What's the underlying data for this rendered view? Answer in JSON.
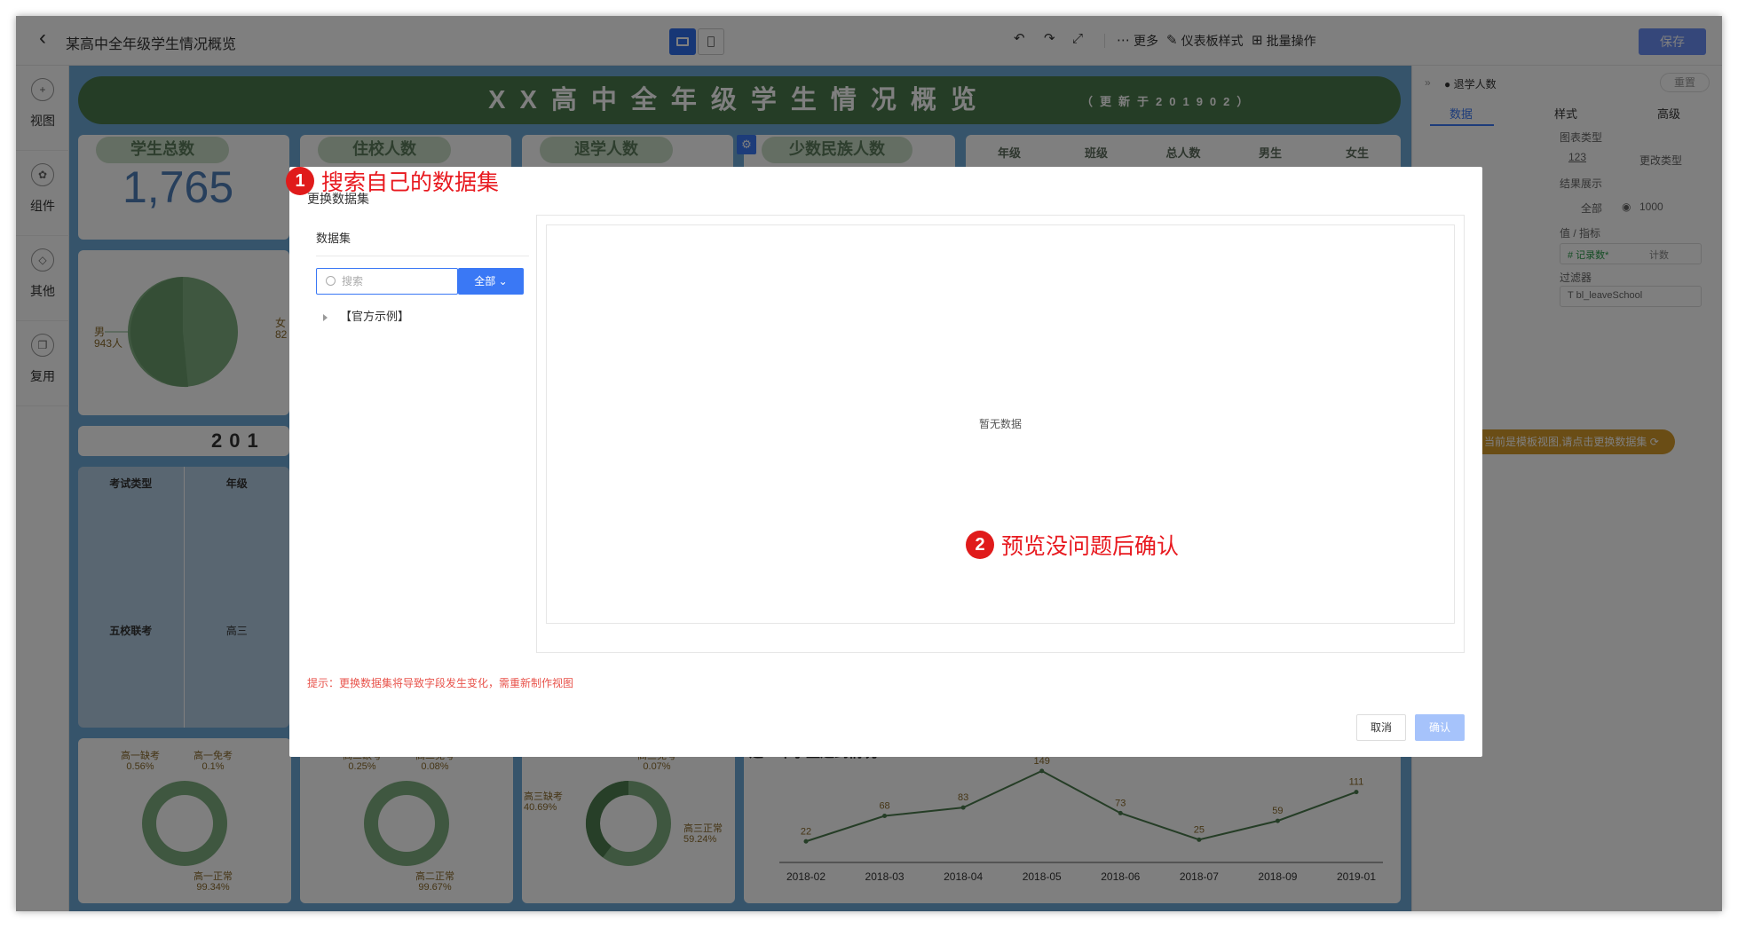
{
  "topbar": {
    "title": "某高中全年级学生情况概览",
    "actions": {
      "more": "更多",
      "dashboard_style": "仪表板样式",
      "batch": "批量操作",
      "save": "保存"
    }
  },
  "sidebar": {
    "items": [
      {
        "label": "视图"
      },
      {
        "label": "组件"
      },
      {
        "label": "其他"
      },
      {
        "label": "复用"
      }
    ]
  },
  "dashboard": {
    "banner_title": "XX高中全年级学生情况概览",
    "banner_sub": "（更新于201902）",
    "kpi_cards": [
      {
        "title": "学生总数",
        "value": "1,765"
      },
      {
        "title": "住校人数"
      },
      {
        "title": "退学人数"
      },
      {
        "title": "少数民族人数"
      }
    ],
    "table_headers": [
      "年级",
      "班级",
      "总人数",
      "男生",
      "女生"
    ],
    "pie": {
      "left_label": "男",
      "left_value": "943人",
      "right_label": "女",
      "right_value": "82"
    },
    "year_banner": "201",
    "exam_table": {
      "headers": [
        "考试类型",
        "年级"
      ],
      "row": [
        "五校联考",
        "高三"
      ]
    },
    "donuts": [
      {
        "l1": "高一缺考",
        "v1": "0.56%",
        "l2": "高一免考",
        "v2": "0.1%",
        "l3": "高一正常",
        "v3": "99.34%"
      },
      {
        "l1": "高二缺考",
        "v1": "0.25%",
        "l2": "高二免考",
        "v2": "0.08%",
        "l3": "高二正常",
        "v3": "99.67%"
      },
      {
        "l1": "高三缺考",
        "v1": "40.69%",
        "l2": "高三免考",
        "v2": "0.07%",
        "l3": "高三正常",
        "v3": "59.24%"
      }
    ]
  },
  "chart_data": {
    "type": "line",
    "title": "近一年学生迟到情况",
    "categories": [
      "2018-02",
      "2018-03",
      "2018-04",
      "2018-05",
      "2018-06",
      "2018-07",
      "2018-09",
      "2019-01"
    ],
    "values": [
      22,
      68,
      83,
      149,
      73,
      25,
      59,
      111
    ],
    "ylim": [
      0,
      160
    ],
    "grid": false,
    "color": "#4a7a4c"
  },
  "right_panel": {
    "header": "退学人数",
    "reset": "重置",
    "tabs": [
      "数据",
      "样式",
      "高级"
    ],
    "chart_type_label": "图表类型",
    "chart_type_value": "123",
    "change_type": "更改类型",
    "result_show": "结果展示",
    "result_all": "全部",
    "result_n": "1000",
    "value_metric": "值 / 指标",
    "metric_name": "# 记录数*",
    "metric_agg": "计数",
    "filter": "过滤器",
    "filter_name": "T bl_leaveSchool",
    "template_tip": "当前是模板视图,请点击更换数据集"
  },
  "modal": {
    "title": "更换数据集",
    "dataset_label": "数据集",
    "search_placeholder": "搜索",
    "all_button": "全部",
    "tree_item": "【官方示例】",
    "empty_text": "暂无数据",
    "hint": "提示：更换数据集将导致字段发生变化，需重新制作视图",
    "cancel": "取消",
    "confirm": "确认"
  },
  "callouts": [
    {
      "num": "1",
      "text": "搜索自己的数据集"
    },
    {
      "num": "2",
      "text": "预览没问题后确认"
    }
  ],
  "colors": {
    "accent": "#3a78f5",
    "brand_green": "#4a7a4c",
    "canvas_bg": "#6da8d6",
    "callout_red": "#e01b1b"
  }
}
